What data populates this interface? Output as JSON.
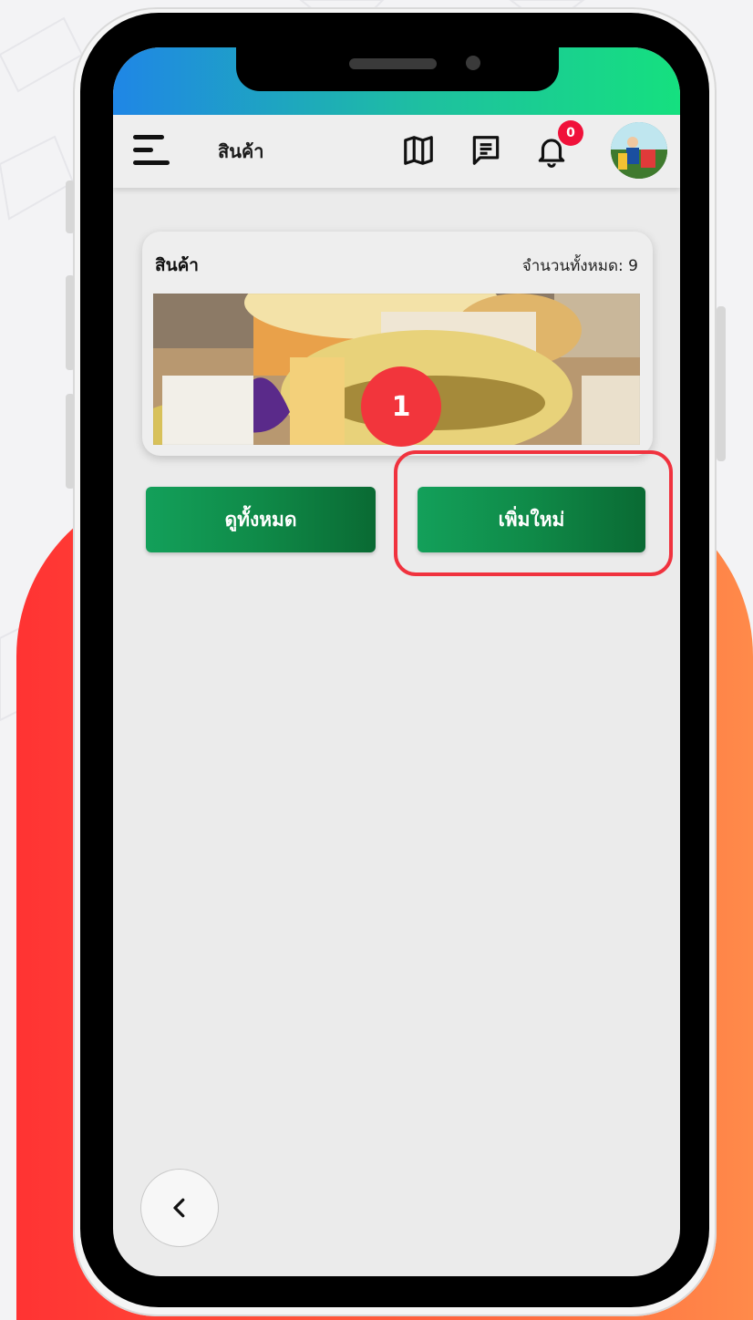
{
  "app_bar": {
    "title": "สินค้า",
    "notification_count": "0"
  },
  "products_card": {
    "title": "สินค้า",
    "count_text": "จำนวนทั้งหมด: 9",
    "step_badge": "1"
  },
  "buttons": {
    "view_all": "ดูทั้งหมด",
    "add_new": "เพิ่มใหม่"
  },
  "icons": {
    "menu": "menu-icon",
    "map": "map-icon",
    "chat": "message-icon",
    "bell": "bell-icon",
    "back": "chevron-left-icon"
  },
  "colors": {
    "accent_green": "#0f8a48",
    "badge_red": "#f0113a",
    "highlight_red": "#f0323e"
  }
}
